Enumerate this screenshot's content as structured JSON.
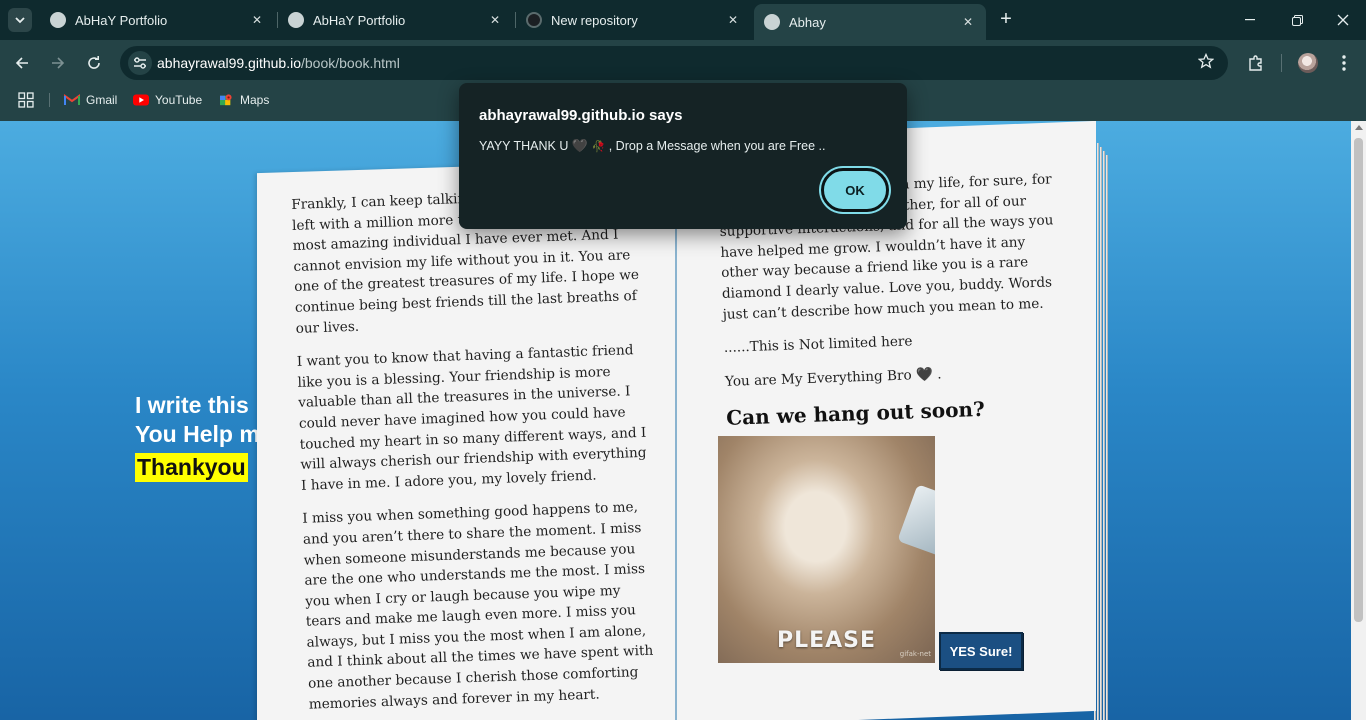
{
  "browser": {
    "tabs": [
      {
        "title": "AbHaY Portfolio",
        "active": false
      },
      {
        "title": "AbHaY Portfolio",
        "active": false
      },
      {
        "title": "New repository",
        "active": false
      },
      {
        "title": "Abhay",
        "active": true
      }
    ],
    "url": {
      "host": "abhayrawal99.github.io",
      "path": "/book/book.html"
    },
    "bookmarks": [
      {
        "label": "Gmail",
        "icon": "gmail-icon"
      },
      {
        "label": "YouTube",
        "icon": "youtube-icon"
      },
      {
        "label": "Maps",
        "icon": "maps-icon"
      }
    ],
    "accent": "#244346"
  },
  "dialog": {
    "title": "abhayrawal99.github.io says",
    "message_prefix": "YAYY THANK U",
    "message_heart": "🖤",
    "message_rose": "🥀",
    "message_suffix": ", Drop a Message when you are Free ..",
    "ok_label": "OK"
  },
  "page": {
    "side_text_line1": "I write this",
    "side_text_line2": "You Help m",
    "side_highlight": "Thankyou",
    "left_paragraphs": [
      "Frankly, I can keep talking about you and still be left with a million more things to say. You are the most amazing individual I have ever met. And I cannot envision my life without you in it. You are one of the greatest treasures of my life. I hope we continue being best friends till the last breaths of our lives.",
      "I want you to know that having a fantastic friend like you is a blessing. Your friendship is more valuable than all the treasures in the universe. I could never have imagined how you could have touched my heart in so many different ways, and I will always cherish our friendship with everything I have in me. I adore you, my lovely friend.",
      "I miss you when something good happens to me, and you aren’t there to share the moment. I miss when someone misunderstands me because you are the one who understands me the most. I miss you when I cry or laugh because you wipe my tears and make me laugh even more. I miss you always, but I miss you the most when I am alone, and I think about all the times we have spent with one another because I cherish those comforting memories always and forever in my heart."
    ],
    "right_paragraph": "I am grateful to have you in my life, for sure, for all of our happy times together, for all of our supportive interactions, and for all the ways you have helped me grow. I wouldn’t have it any other way because a friend like you is a rare diamond I dearly value. Love you, buddy. Words just can’t describe how much you mean to me.",
    "not_limited": "......This is Not limited here",
    "everything_text": "You are My Everything Bro",
    "everything_heart": "🖤",
    "everything_end": ".",
    "hangout_title": "Can we hang out soon?",
    "gif_caption": "PLEASE",
    "gif_watermark": "gifak-net",
    "yes_label": "YES Sure!"
  }
}
